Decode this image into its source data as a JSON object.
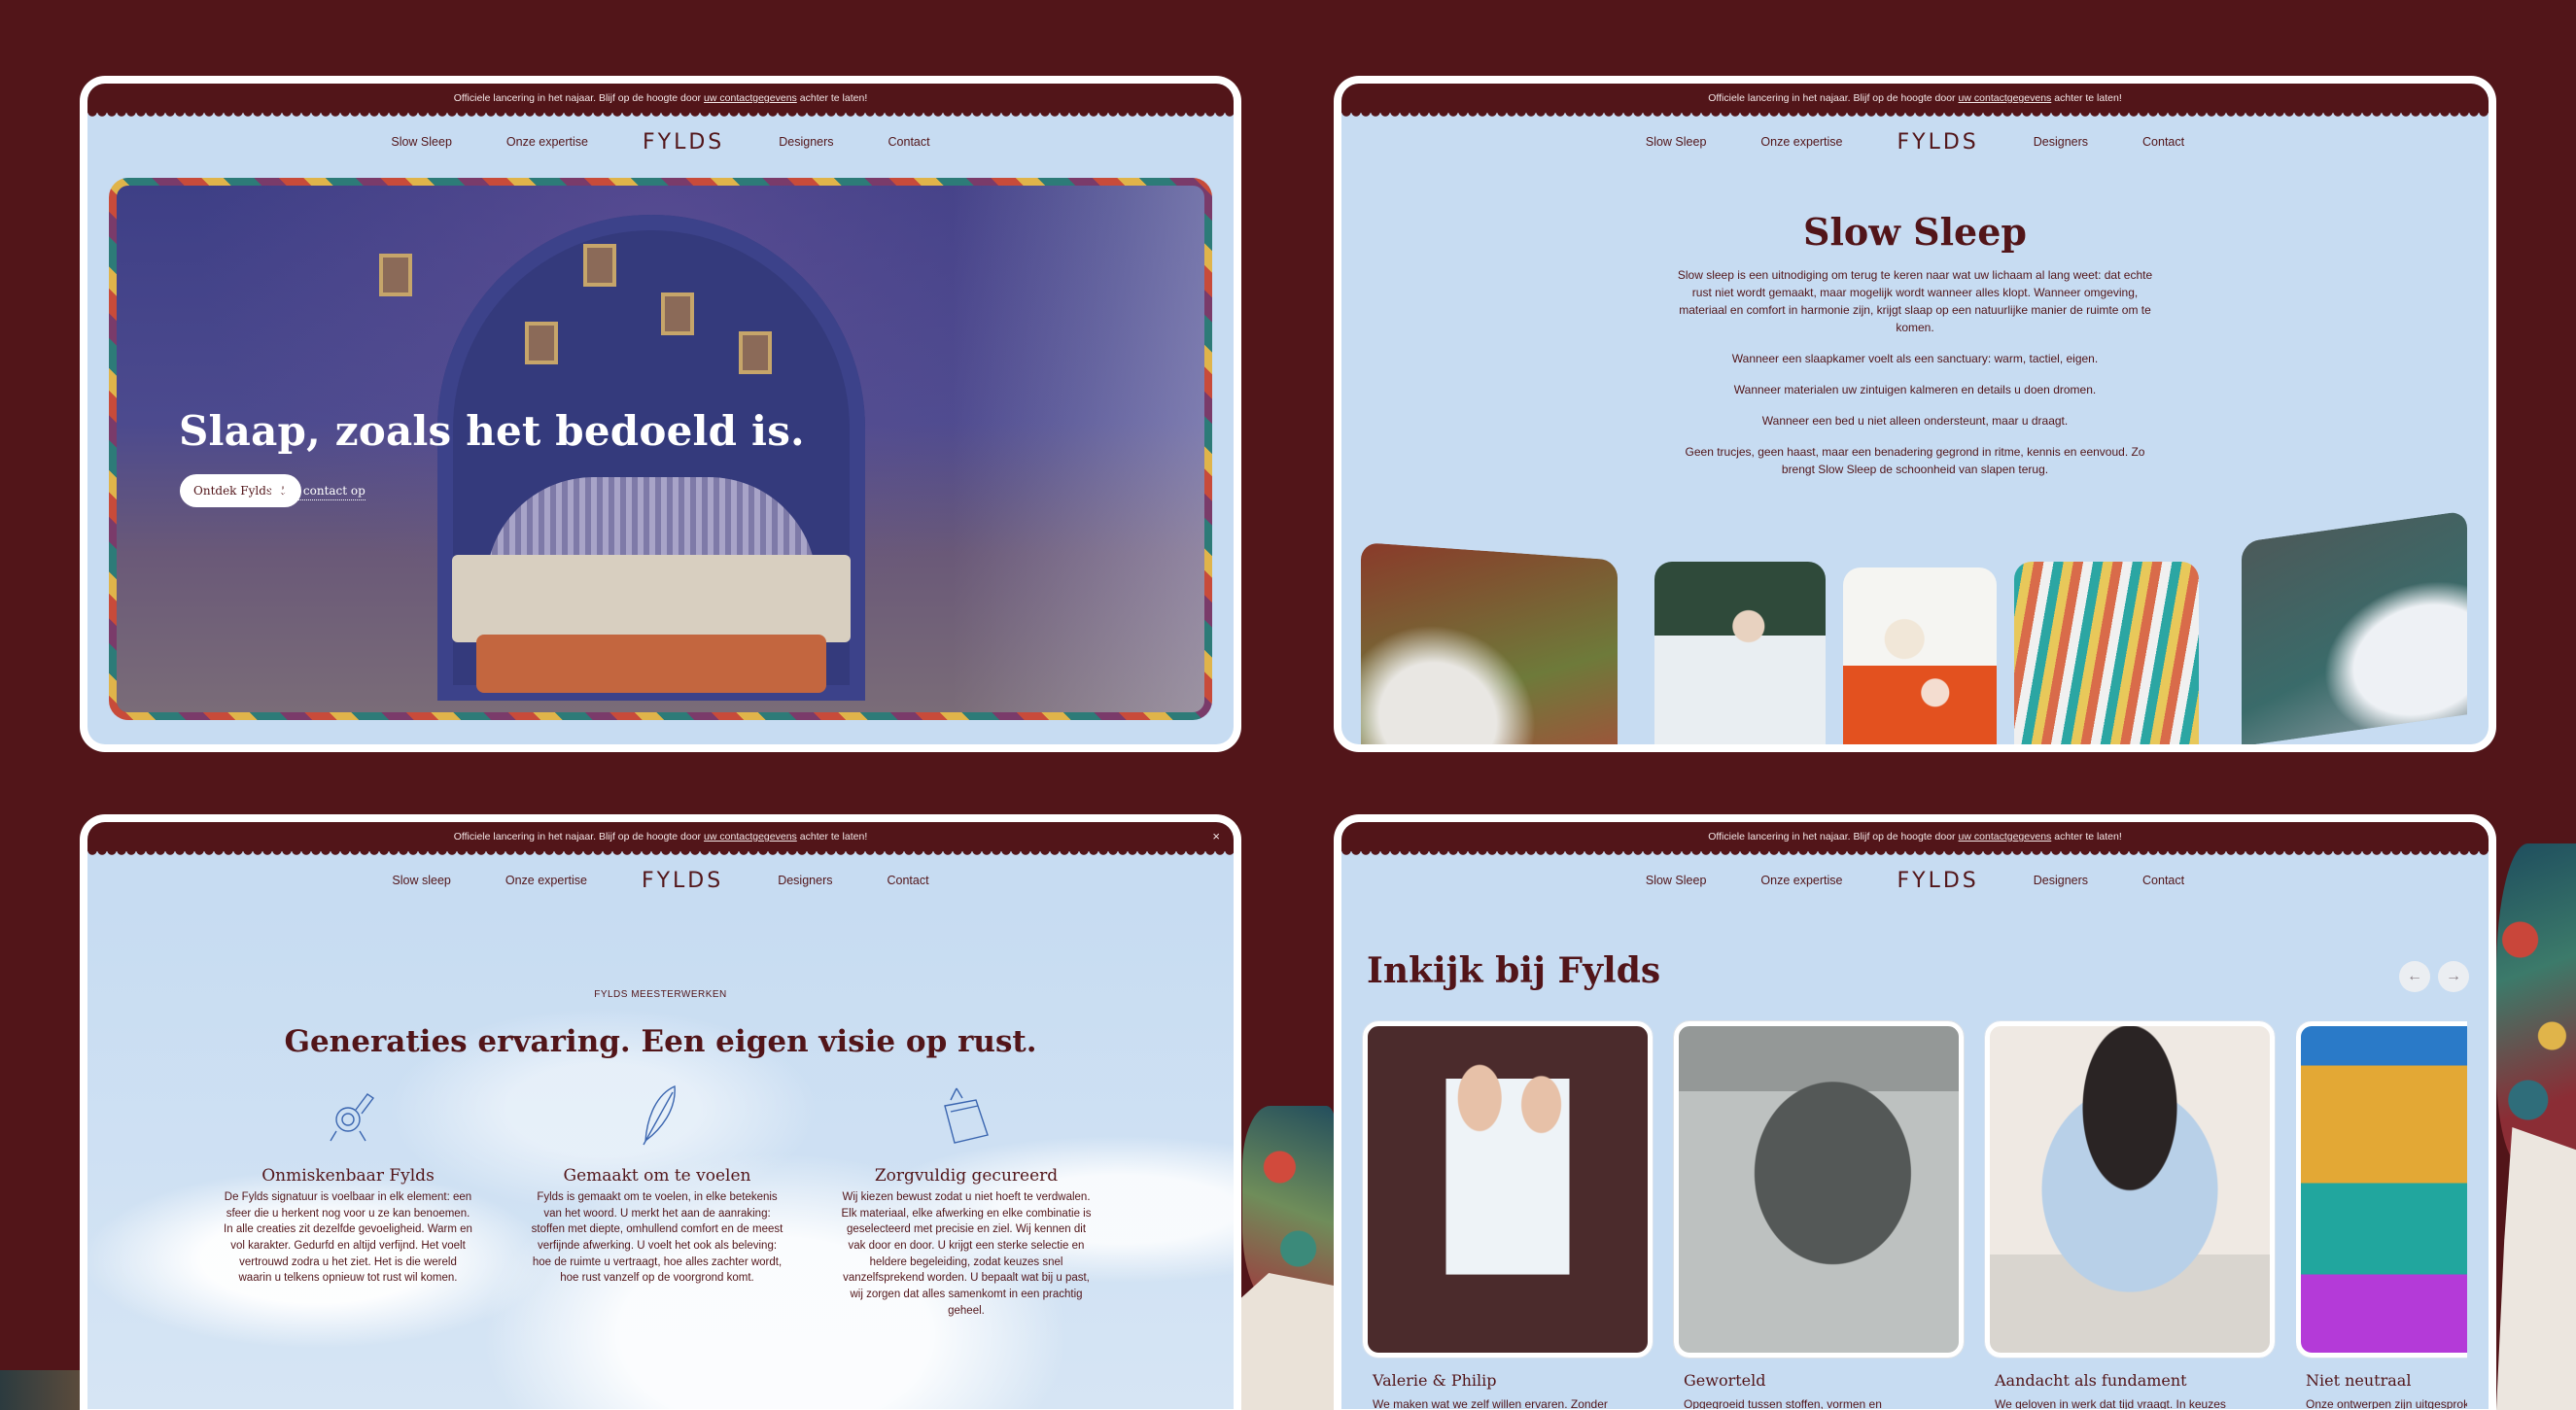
{
  "announcement": {
    "text_before": "Officiele lancering in het najaar. Blijf op de hoogte door",
    "link": "uw contactgegevens",
    "text_after": "achter te laten!",
    "close": "×"
  },
  "nav": {
    "items_left": [
      "Slow Sleep",
      "Onze expertise"
    ],
    "items_left_alt": [
      "Slow sleep",
      "Onze expertise"
    ],
    "logo": "FYLDS",
    "items_right": [
      "Designers",
      "Contact"
    ]
  },
  "hero": {
    "title": "Slaap, zoals het bedoeld is.",
    "primary_button": "Ontdek Fylds",
    "primary_icon": "arrow-down-icon",
    "secondary_link": "Neem contact op"
  },
  "slow_sleep": {
    "title": "Slow Sleep",
    "paragraphs": [
      "Slow sleep is een uitnodiging om terug te keren naar wat uw lichaam al lang weet: dat echte rust niet wordt gemaakt, maar mogelijk wordt wanneer alles klopt. Wanneer omgeving, materiaal en comfort in harmonie zijn, krijgt slaap op een natuurlijke manier de ruimte om te komen.",
      "Wanneer een slaapkamer voelt als een sanctuary: warm, tactiel, eigen.",
      "Wanneer materialen uw zintuigen kalmeren en details u doen dromen.",
      "Wanneer een bed u niet alleen ondersteunt, maar u draagt.",
      "Geen trucjes, geen haast, maar een benadering gegrond in ritme, kennis en eenvoud. Zo brengt Slow Sleep de schoonheid van slapen terug."
    ]
  },
  "meesterwerken": {
    "eyebrow": "FYLDS MEESTERWERKEN",
    "title": "Generaties ervaring. Een eigen visie op rust.",
    "columns": [
      {
        "icon": "seal-stamp-icon",
        "title": "Onmiskenbaar Fylds",
        "text": "De Fylds signatuur is voelbaar in elk element: een sfeer die u herkent nog voor u ze kan benoemen. In alle creaties zit dezelfde gevoeligheid. Warm en vol karakter. Gedurfd en altijd verfijnd. Het voelt vertrouwd zodra u het ziet. Het is die wereld waarin u telkens opnieuw tot rust wil komen."
      },
      {
        "icon": "feather-icon",
        "title": "Gemaakt om te voelen",
        "text": "Fylds is gemaakt om te voelen, in elke betekenis van het woord. U merkt het aan de aanraking: stoffen met diepte, omhullend comfort en de meest verfijnde afwerking. U voelt het ook als beleving: hoe de ruimte u vertraagt, hoe alles zachter wordt, hoe rust vanzelf op de voorgrond komt."
      },
      {
        "icon": "fabric-swatch-icon",
        "title": "Zorgvuldig gecureerd",
        "text": "Wij kiezen bewust zodat u niet hoeft te verdwalen. Elk materiaal, elke afwerking en elke combinatie is geselecteerd met precisie en ziel. Wij kennen dit vak door en door. U krijgt een sterke selectie en heldere begeleiding, zodat keuzes snel vanzelfsprekend worden. U bepaalt wat bij u past, wij zorgen dat alles samenkomt in een prachtig geheel."
      }
    ]
  },
  "inkijk": {
    "title": "Inkijk bij Fylds",
    "prev": "←",
    "next": "→",
    "cards": [
      {
        "title": "Valerie & Philip",
        "text": "We maken wat we zelf willen ervaren. Zonder"
      },
      {
        "title": "Geworteld",
        "text": "Opgegroeid tussen stoffen, vormen en"
      },
      {
        "title": "Aandacht als fundament",
        "text": "We geloven in werk dat tijd vraagt. In keuzes"
      },
      {
        "title": "Niet neutraal",
        "text": "Onze ontwerpen zijn uitgesproken"
      }
    ]
  },
  "colors": {
    "background": "#521519",
    "screen": "#c7dcf2",
    "text": "#521519"
  }
}
